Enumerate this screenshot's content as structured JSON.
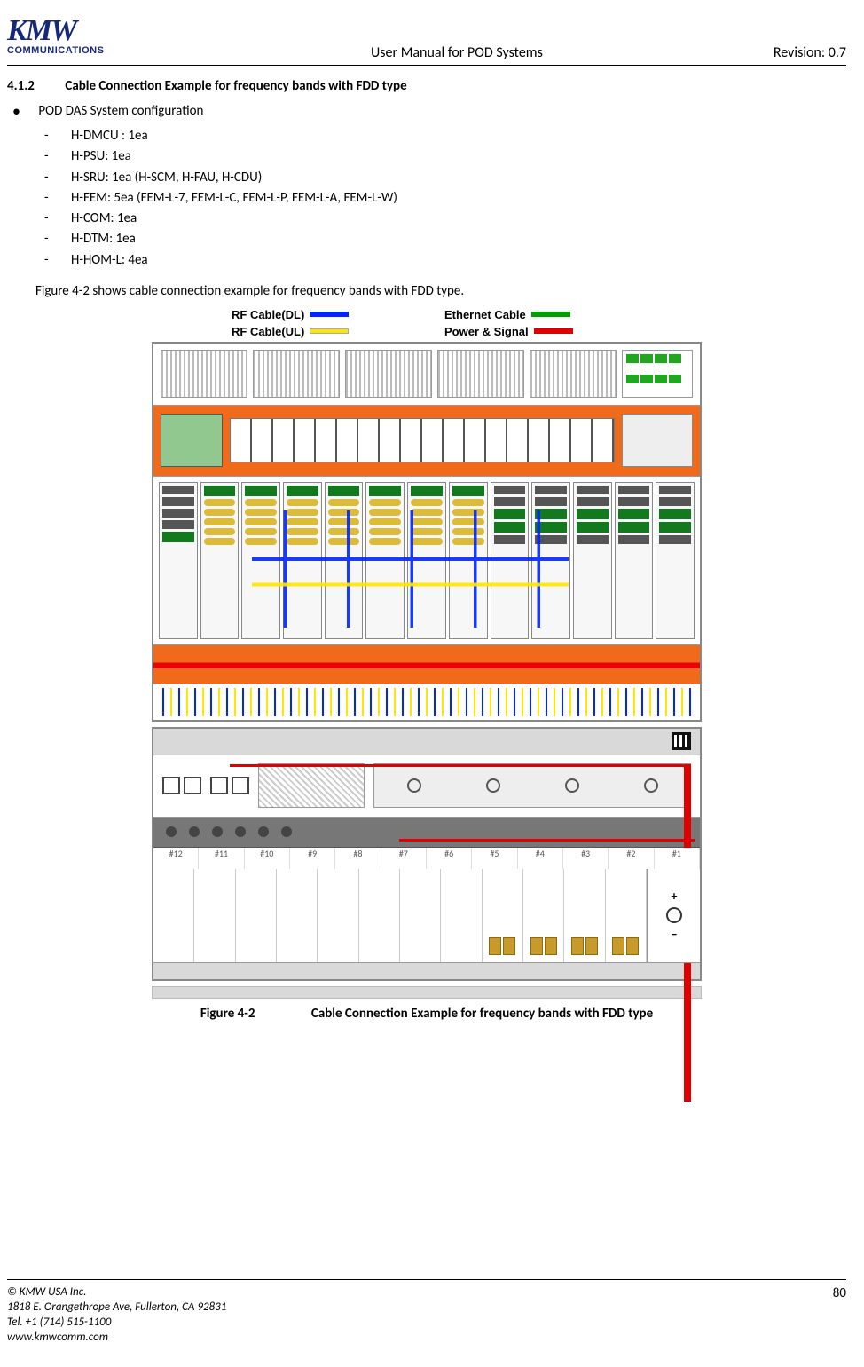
{
  "header": {
    "logo_main": "KMW",
    "logo_sub": "COMMUNICATIONS",
    "title": "User Manual for POD Systems",
    "revision": "Revision: 0.7"
  },
  "section": {
    "number": "4.1.2",
    "title": "Cable Connection Example for frequency bands with FDD type"
  },
  "bullet": "POD DAS System configuration",
  "config_items": [
    "H-DMCU : 1ea",
    "H-PSU: 1ea",
    "H-SRU: 1ea (H-SCM, H-FAU, H-CDU)",
    "H-FEM: 5ea (FEM-L-7, FEM-L-C, FEM-L-P, FEM-L-A, FEM-L-W)",
    "H-COM: 1ea",
    "H-DTM: 1ea",
    "H-HOM-L: 4ea"
  ],
  "intro_para": "Figure 4-2 shows cable connection example for frequency bands with FDD type.",
  "legend": {
    "rf_dl": "RF Cable(DL)",
    "rf_ul": "RF Cable(UL)",
    "eth": "Ethernet Cable",
    "pwr": "Power & Signal"
  },
  "slot_labels": [
    "#12",
    "#11",
    "#10",
    "#9",
    "#8",
    "#7",
    "#6",
    "#5",
    "#4",
    "#3",
    "#2",
    "#1"
  ],
  "figure": {
    "number": "Figure 4-2",
    "caption": "Cable Connection Example for frequency bands with FDD type"
  },
  "footer": {
    "copyright": "© KMW USA Inc.",
    "address": "1818 E. Orangethrope Ave, Fullerton, CA 92831",
    "tel": "Tel. +1 (714) 515-1100",
    "web": "www.kmwcomm.com",
    "page": "80"
  }
}
